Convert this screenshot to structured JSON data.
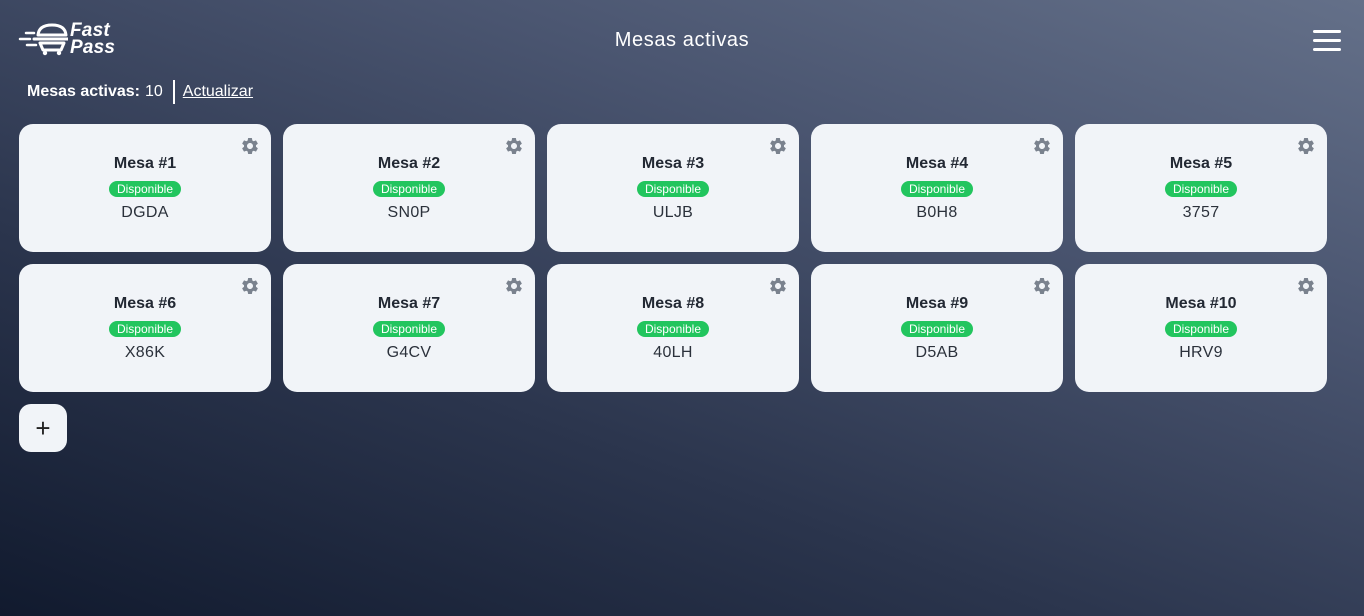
{
  "header": {
    "logo_text_line1": "Fast",
    "logo_text_line2": "Pass",
    "title": "Mesas activas",
    "menu_icon": "hamburger-menu-icon"
  },
  "status": {
    "label": "Mesas activas:",
    "count": "10",
    "refresh_label": "Actualizar"
  },
  "tables": [
    {
      "title": "Mesa #1",
      "status": "Disponible",
      "code": "DGDA"
    },
    {
      "title": "Mesa #2",
      "status": "Disponible",
      "code": "SN0P"
    },
    {
      "title": "Mesa #3",
      "status": "Disponible",
      "code": "ULJB"
    },
    {
      "title": "Mesa #4",
      "status": "Disponible",
      "code": "B0H8"
    },
    {
      "title": "Mesa #5",
      "status": "Disponible",
      "code": "3757"
    },
    {
      "title": "Mesa #6",
      "status": "Disponible",
      "code": "X86K"
    },
    {
      "title": "Mesa #7",
      "status": "Disponible",
      "code": "G4CV"
    },
    {
      "title": "Mesa #8",
      "status": "Disponible",
      "code": "40LH"
    },
    {
      "title": "Mesa #9",
      "status": "Disponible",
      "code": "D5AB"
    },
    {
      "title": "Mesa #10",
      "status": "Disponible",
      "code": "HRV9"
    }
  ],
  "add_button": {
    "label": "+"
  },
  "colors": {
    "status_available": "#22c55e",
    "card_background": "#f1f4f8",
    "gear_icon": "#7a828e"
  }
}
